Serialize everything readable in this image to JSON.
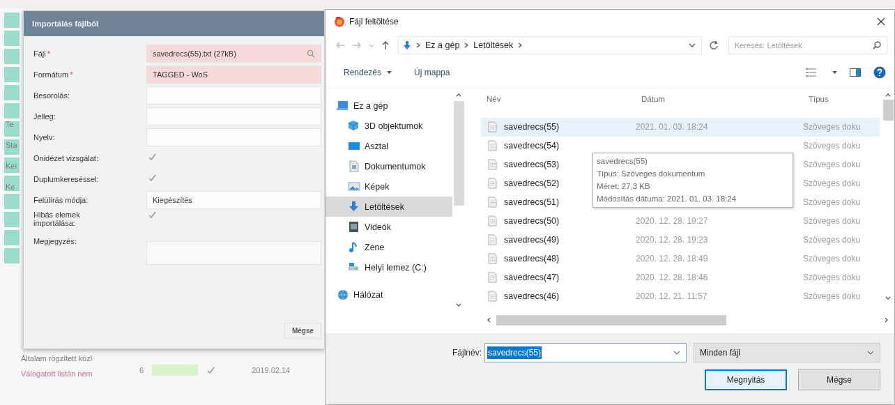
{
  "background": {
    "side_labels": [
      "Te",
      "Sta",
      "Ker",
      "Ke"
    ],
    "list_items": [
      {
        "text": "Általam rögzített közl",
        "color": "#7a7a7a"
      },
      {
        "text": "Válogatott listán nem",
        "color": "#c0709a"
      }
    ],
    "row": {
      "number": "6",
      "checked": true,
      "date": "2019.02.14"
    }
  },
  "import_dialog": {
    "title": "Importálás fájlból",
    "fields": [
      {
        "kind": "search",
        "label": "Fájl",
        "required_mark": "*",
        "value": "savedrecs(55).txt (27kB)"
      },
      {
        "kind": "text",
        "label": "Formátum",
        "required_mark": "*",
        "value": "TAGGED - WoS"
      },
      {
        "kind": "text",
        "label": "Besorolás:"
      },
      {
        "kind": "text",
        "label": "Jelleg:"
      },
      {
        "kind": "text",
        "label": "Nyelv:"
      },
      {
        "kind": "check",
        "label": "Önidézet vizsgálat:",
        "checked": true
      },
      {
        "kind": "check",
        "label": "Duplumkereséssel:",
        "checked": true
      },
      {
        "kind": "text",
        "label": "Felülírás módja:",
        "value": "Kiegészítés"
      },
      {
        "kind": "check",
        "label": "Hibás elemek importálása:",
        "checked": true
      },
      {
        "kind": "area",
        "label": "Megjegyzés:"
      }
    ],
    "cancel_button": "Mégse"
  },
  "file_dialog": {
    "title": "Fájl feltöltése",
    "path": [
      "Ez a gép",
      "Letöltések"
    ],
    "search_placeholder": "Keresés: Letöltések",
    "toolbar": [
      "Rendezés",
      "Új mappa"
    ],
    "nav": [
      {
        "kind": "pc",
        "label": "Ez a gép",
        "selected": false
      },
      {
        "kind": "cube",
        "label": "3D objektumok",
        "selected": false
      },
      {
        "kind": "desktop",
        "label": "Asztal",
        "selected": false
      },
      {
        "kind": "doc",
        "label": "Dokumentumok",
        "selected": false
      },
      {
        "kind": "pics",
        "label": "Képek",
        "selected": false
      },
      {
        "kind": "down",
        "label": "Letöltések",
        "selected": true
      },
      {
        "kind": "video",
        "label": "Videók",
        "selected": false
      },
      {
        "kind": "music",
        "label": "Zene",
        "selected": false
      },
      {
        "kind": "drive",
        "label": "Helyi lemez (C:)",
        "selected": false
      },
      {
        "kind": "net",
        "label": "Hálózat",
        "selected": false
      }
    ],
    "columns": [
      "Név",
      "Dátum",
      "Típus"
    ],
    "rows": [
      {
        "name": "savedrecs(55)",
        "date": "2021. 01. 03. 18:24",
        "type": "Szöveges doku",
        "selected": true
      },
      {
        "name": "savedrecs(54)",
        "type": "Szöveges doku",
        "selected": false
      },
      {
        "name": "savedrecs(53)",
        "type": "Szöveges doku",
        "selected": false
      },
      {
        "name": "savedrecs(52)",
        "type": "Szöveges doku",
        "selected": false
      },
      {
        "name": "savedrecs(51)",
        "type": "Szöveges doku",
        "selected": false
      },
      {
        "name": "savedrecs(50)",
        "date": "2020. 12. 28. 19:27",
        "type": "Szöveges doku",
        "selected": false
      },
      {
        "name": "savedrecs(49)",
        "date": "2020. 12. 28. 19:23",
        "type": "Szöveges doku",
        "selected": false
      },
      {
        "name": "savedrecs(48)",
        "date": "2020. 12. 28. 18:49",
        "type": "Szöveges doku",
        "selected": false
      },
      {
        "name": "savedrecs(47)",
        "date": "2020. 12. 28. 18:46",
        "type": "Szöveges doku",
        "selected": false
      },
      {
        "name": "savedrecs(46)",
        "date": "2020. 12. 21. 11:57",
        "type": "Szöveges doku",
        "selected": false
      }
    ],
    "tooltip": [
      "savedrecs(55)",
      "Típus: Szöveges dokumentum",
      "Méret: 27,3 KB",
      "Módosítás dátuma: 2021. 01. 03. 18:24"
    ],
    "filename_label": "Fájlnév:",
    "filename_value": "savedrecs(55)",
    "filename_selected": true,
    "filter": "Minden fájl",
    "buttons": [
      {
        "label": "Megnyitás",
        "default": true
      },
      {
        "label": "Mégse",
        "default": false
      }
    ]
  }
}
